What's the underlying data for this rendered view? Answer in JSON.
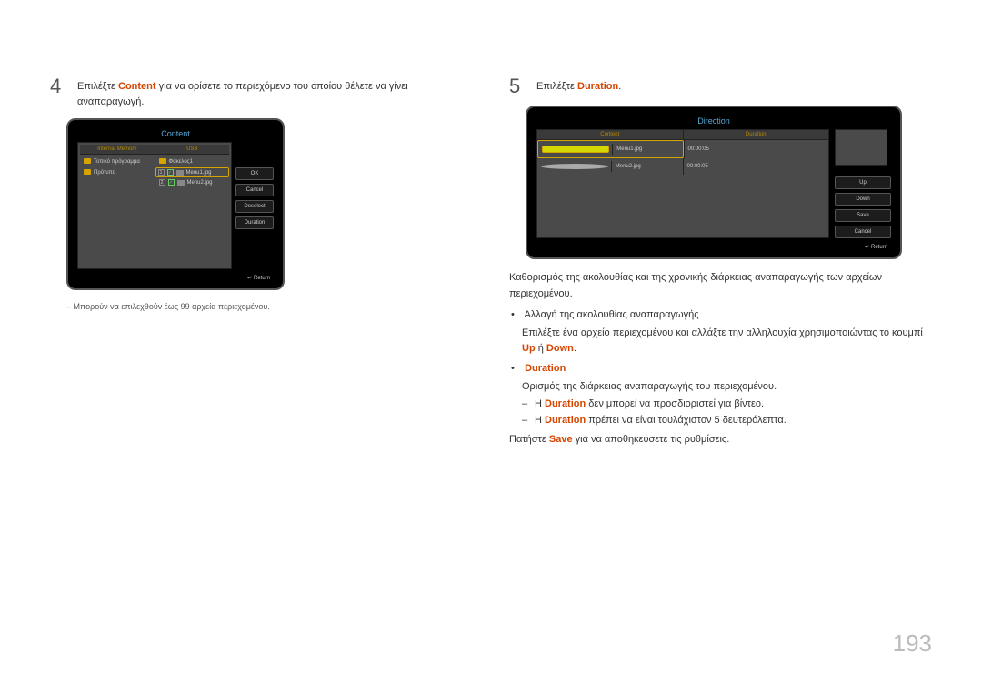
{
  "page_number": "193",
  "left": {
    "step_num": "4",
    "step_text_1": "Επιλέξτε ",
    "step_text_kw": "Content",
    "step_text_2": " για να ορίσετε το περιεχόμενο του οποίου θέλετε να γίνει αναπαραγωγή.",
    "note": "Μπορούν να επιλεχθούν έως 99 αρχεία περιεχομένου.",
    "screen": {
      "title": "Content",
      "tab1": "Internal Memory",
      "tab2": "USB",
      "l1": "Τοπικό πρόγραμμα",
      "l2": "Πρότυπα",
      "r0": "Φάκελος1",
      "r1_num": "1",
      "r1": "Menu1.jpg",
      "r2_num": "2",
      "r2": "Menu2.jpg",
      "btn_ok": "OK",
      "btn_cancel": "Cancel",
      "btn_deselect": "Deselect",
      "btn_duration": "Duration",
      "return": "Return"
    }
  },
  "right": {
    "step_num": "5",
    "step_text_1": "Επιλέξτε ",
    "step_text_kw": "Duration",
    "step_text_2": ".",
    "screen": {
      "title": "Direction",
      "h1": "Content",
      "h2": "Duration",
      "r1_name": "Menu1.jpg",
      "r1_dur": "00:00:05",
      "r2_name": "Menu2.jpg",
      "r2_dur": "00:00:05",
      "btn_up": "Up",
      "btn_down": "Down",
      "btn_save": "Save",
      "btn_cancel": "Cancel",
      "return": "Return"
    },
    "p1": "Καθορισμός της ακολουθίας και της χρονικής διάρκειας αναπαραγωγής των αρχείων περιεχομένου.",
    "b1": "Αλλαγή της ακολουθίας αναπαραγωγής",
    "b1_sub_a": "Επιλέξτε ένα αρχείο περιεχομένου και αλλάξτε την αλληλουχία χρησιμοποιώντας το κουμπί ",
    "b1_kw_up": "Up",
    "b1_or": " ή ",
    "b1_kw_down": "Down",
    "b1_dot": ".",
    "b2_kw": "Duration",
    "b2_sub": "Ορισμός της διάρκειας αναπαραγωγής του περιεχομένου.",
    "b2_s1_a": "Η ",
    "b2_s1_kw": "Duration",
    "b2_s1_b": " δεν μπορεί να προσδιοριστεί για βίντεο.",
    "b2_s2_a": "Η ",
    "b2_s2_kw": "Duration",
    "b2_s2_b": " πρέπει να είναι τουλάχιστον 5 δευτερόλεπτα.",
    "p2_a": "Πατήστε ",
    "p2_kw": "Save",
    "p2_b": " για να αποθηκεύσετε τις ρυθμίσεις."
  }
}
